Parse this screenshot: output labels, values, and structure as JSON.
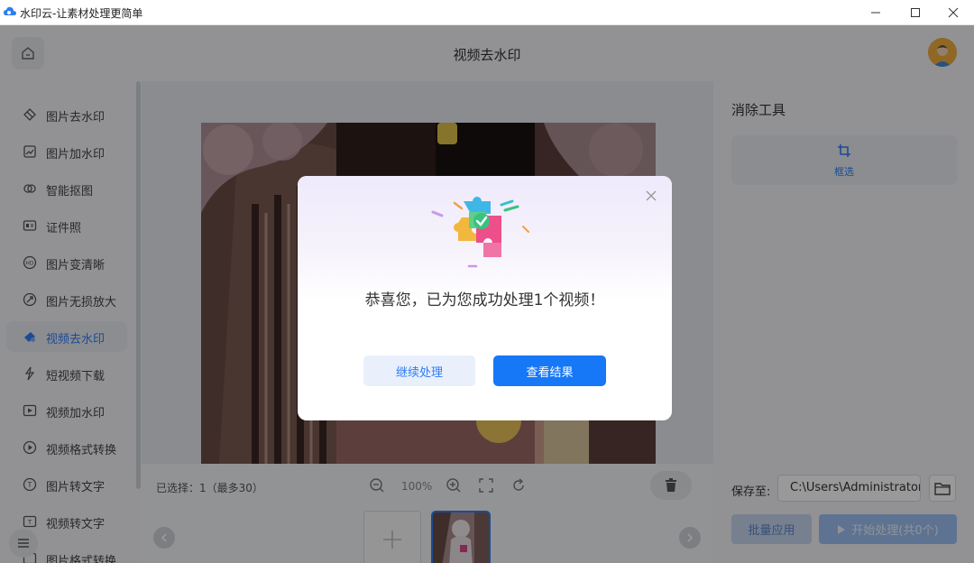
{
  "window": {
    "title": "水印云-让素材处理更简单",
    "minimize_icon": "minimize-icon",
    "maximize_icon": "maximize-icon",
    "close_icon": "close-icon"
  },
  "header": {
    "title": "视频去水印",
    "home_icon": "home-icon",
    "avatar": "user-avatar"
  },
  "sidebar": {
    "items": [
      {
        "label": "图片去水印",
        "icon": "eraser-icon"
      },
      {
        "label": "图片加水印",
        "icon": "image-add-icon"
      },
      {
        "label": "智能抠图",
        "icon": "cutout-icon"
      },
      {
        "label": "证件照",
        "icon": "id-card-icon"
      },
      {
        "label": "图片变清晰",
        "icon": "hd-icon"
      },
      {
        "label": "图片无损放大",
        "icon": "enlarge-icon"
      },
      {
        "label": "视频去水印",
        "icon": "video-eraser-icon",
        "active": true
      },
      {
        "label": "短视频下载",
        "icon": "download-icon"
      },
      {
        "label": "视频加水印",
        "icon": "video-add-icon"
      },
      {
        "label": "视频格式转换",
        "icon": "video-convert-icon"
      },
      {
        "label": "图片转文字",
        "icon": "image-text-icon"
      },
      {
        "label": "视频转文字",
        "icon": "video-text-icon"
      },
      {
        "label": "图片格式转换",
        "icon": "image-convert-icon"
      }
    ]
  },
  "editor": {
    "selected_text": "已选择：1（最多30）",
    "zoom": "100%",
    "tools": [
      "zoom-out-icon",
      "zoom-in-icon",
      "fit-screen-icon",
      "rotate-icon"
    ]
  },
  "right_panel": {
    "title": "消除工具",
    "select_tool_label": "框选",
    "save_label": "保存至:",
    "save_path": "C:\\Users\\Administrator",
    "batch_button": "批量应用",
    "start_button": "开始处理(共0个)"
  },
  "dialog": {
    "message": "恭喜您，已为您成功处理1个视频！",
    "continue_button": "继续处理",
    "view_button": "查看结果"
  },
  "colors": {
    "accent": "#1677f7",
    "sidebar_active": "#2f7cf6",
    "overlay": "rgba(0,0,0,0.40)"
  }
}
